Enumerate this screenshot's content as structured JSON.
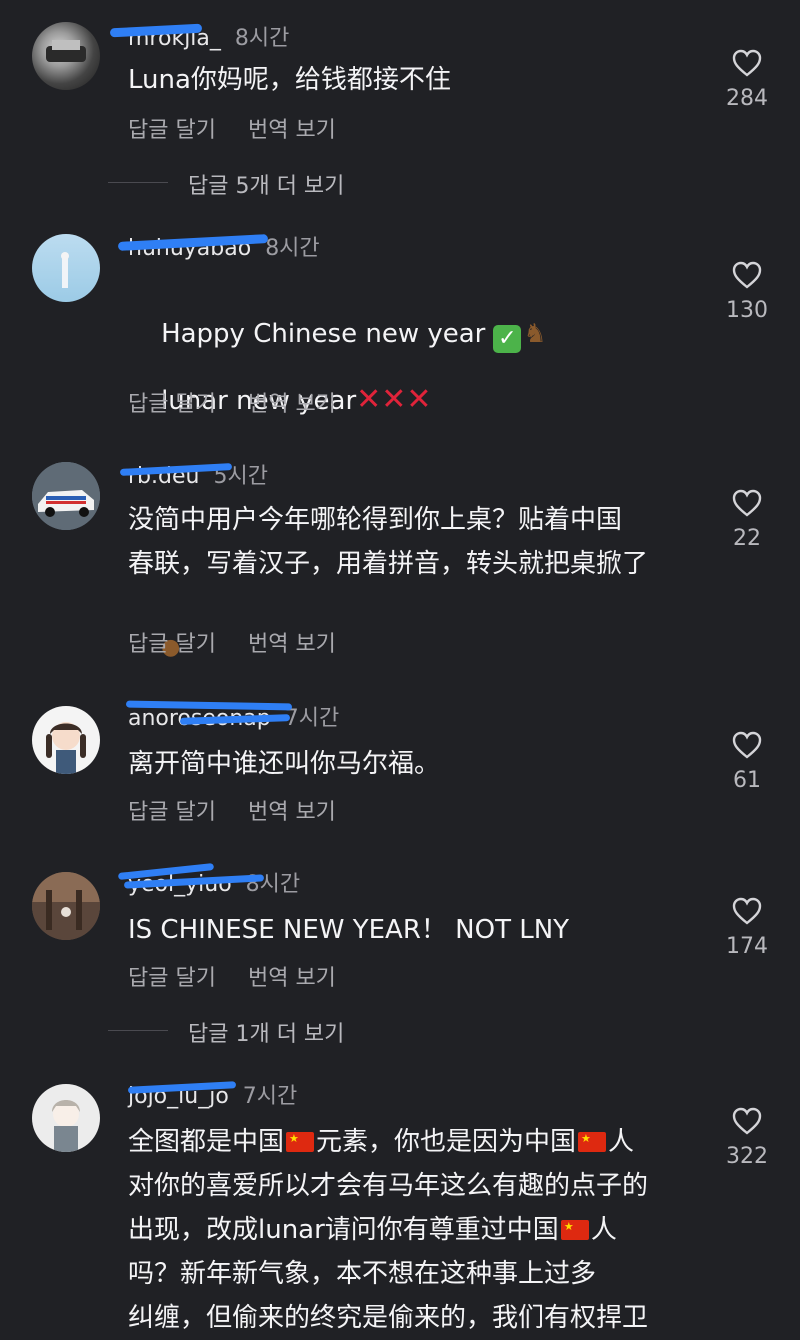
{
  "actions": {
    "reply": "답글 달기",
    "translate": "번역 보기"
  },
  "comments": [
    {
      "user": "mrokjia_",
      "time": "8시간",
      "text": "Luna你妈呢，给钱都接不住",
      "likes": "284"
    },
    {
      "user": "huhuyabao",
      "time": "8시간",
      "text": "Happy Chinese new year",
      "text2": "lunar new year",
      "likes": "130"
    },
    {
      "user": "rb.deu",
      "time": "5시간",
      "text": "没简中用户今年哪轮得到你上桌？贴着中国\n春联，写着汉子，用着拼音，转头就把桌掀了",
      "likes": "22"
    },
    {
      "user": "anoroseonap",
      "time": "7시간",
      "text": "离开简中谁还叫你马尔福。",
      "likes": "61"
    },
    {
      "user": "yeol_yiuo",
      "time": "8시간",
      "text": "IS CHINESE NEW YEAR！ NOT LNY",
      "likes": "174"
    },
    {
      "user": "jojo_lu_jo",
      "time": "7시간",
      "text_parts": [
        "全图都是中国",
        "元素，你也是因为中国",
        "人",
        "对你的喜爱所以才会有马年这么有趣的点子的",
        "出现，改成lunar请问你有尊重过中国",
        "人",
        "吗？新年新气象，本不想在这种事上过多",
        "纠缠，但偷来的终究是偷来的，我们有权捍卫"
      ],
      "likes": "322"
    }
  ],
  "more_replies": [
    "답글 5개 더 보기",
    "답글 1개 더 보기"
  ],
  "colors": {
    "background": "#202125",
    "scribble": "#2f7ff5"
  }
}
